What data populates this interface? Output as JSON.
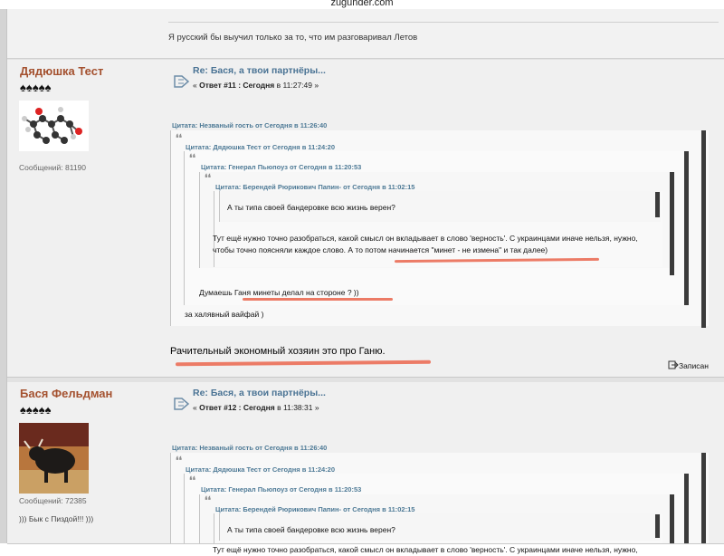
{
  "site": {
    "domain": "zugunder.com"
  },
  "previous_post": {
    "signature": "Я русский бы выучил только за то, что им разговаривал Летов"
  },
  "posts": [
    {
      "author": {
        "name": "Дядюшка Тест",
        "rank_stars": "♠♠♠♠♠",
        "messages": "Сообщений: 81190",
        "personal_text": ""
      },
      "subject": "Re: Бася, а твои партнёры...",
      "reply_prefix": "«",
      "reply_number": "Ответ #11 : Сегодня",
      "reply_time": "в 11:27:49 »",
      "quotes": {
        "q1_header": "Цитата: Незваный гость от Сегодня в 11:26:40",
        "q2_header": "Цитата: Дядюшка Тест от Сегодня в 11:24:20",
        "q3_header": "Цитата: Генерал Пьюпоуз от Сегодня в 11:20:53",
        "q4_header": "Цитата: Берендей Рюрикович Папин- от Сегодня в 11:02:15",
        "q5_text": "А ты типа своей бандеровке всю жизнь верен?",
        "q4_text": "Тут ещё нужно точно разобраться, какой смысл он вкладывает в слово 'верность'. С украинцами иначе нельзя, нужно, чтобы точно поясняли каждое слово. А то потом начинается \"минет - не измена\" и так далее)",
        "q3_text": "Думаешь Ганя минеты делал на стороне ? ))",
        "q1_text": "за халявный вайфай )"
      },
      "body": "Рачительный экономный хозяин это про Ганю.",
      "logged_label": "Записан"
    },
    {
      "author": {
        "name": "Бася Фельдман",
        "rank_stars": "♠♠♠♠♠",
        "messages": "Сообщений: 72385",
        "personal_text": "))) Бык с Пиздой!!! )))"
      },
      "subject": "Re: Бася, а твои партнёры...",
      "reply_prefix": "«",
      "reply_number": "Ответ #12 : Сегодня",
      "reply_time": "в 11:38:31 »",
      "quotes": {
        "q1_header": "Цитата: Незваный гость от Сегодня в 11:26:40",
        "q2_header": "Цитата: Дядюшка Тест от Сегодня в 11:24:20",
        "q3_header": "Цитата: Генерал Пьюпоуз от Сегодня в 11:20:53",
        "q4_header": "Цитата: Берендей Рюрикович Папин- от Сегодня в 11:02:15",
        "q5_text": "А ты типа своей бандеровке всю жизнь верен?",
        "q4_text_partial": "Тут ещё нужно точно разобраться, какой смысл он вкладывает в слово 'верность'. С украинцами иначе нельзя, нужно,"
      }
    }
  ],
  "colors": {
    "username": "#a4512f",
    "quote_link": "#4e7a96",
    "subject": "#4a7394",
    "annotation_underline": "#ec7b66"
  }
}
